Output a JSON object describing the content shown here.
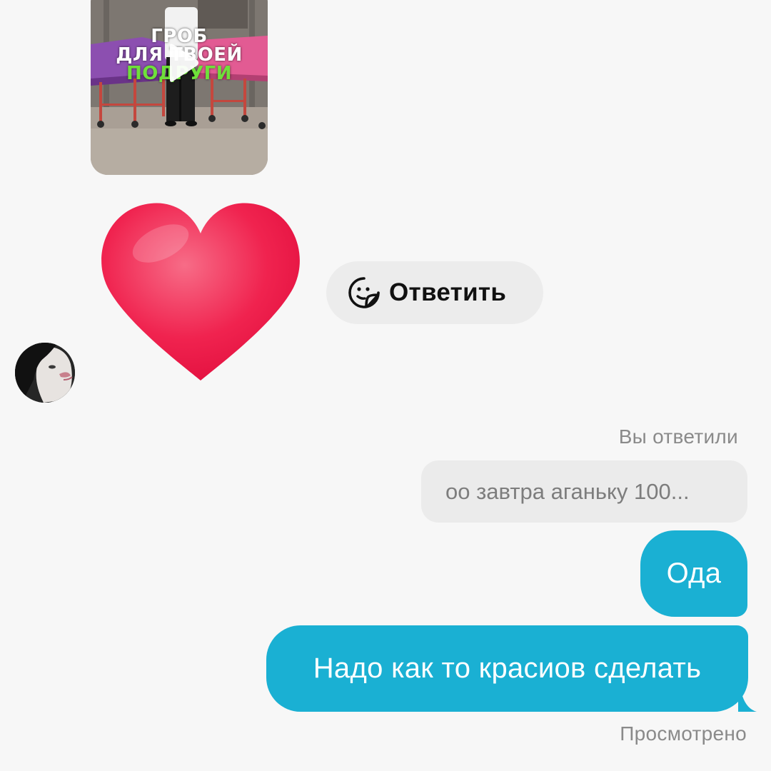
{
  "thread": {
    "shared_video": {
      "caption_lines": [
        "ГРОБ",
        "ДЛЯ ТВОЕЙ",
        "ПОДРУГИ"
      ],
      "icon": "play-icon"
    },
    "reaction": {
      "emoji": "❤️",
      "icon": "heart-icon",
      "color": "#f0174c"
    },
    "reply_chip": {
      "label": "Ответить",
      "icon": "sticker-smile-icon"
    },
    "contact": {
      "avatar": "contact-avatar"
    },
    "replied_label": "Вы ответили",
    "quoted_message": "оо завтра аганьку 100...",
    "outgoing_messages": [
      {
        "text": "Ода"
      },
      {
        "text": "Надо как то красиов сделать"
      }
    ],
    "seen_status": "Просмотрено"
  },
  "colors": {
    "background": "#f7f7f7",
    "outgoing_bubble": "#1ab0d3",
    "quoted_bubble": "#ebebeb",
    "reply_chip": "#ececec",
    "meta_text": "#8a8a8a"
  }
}
